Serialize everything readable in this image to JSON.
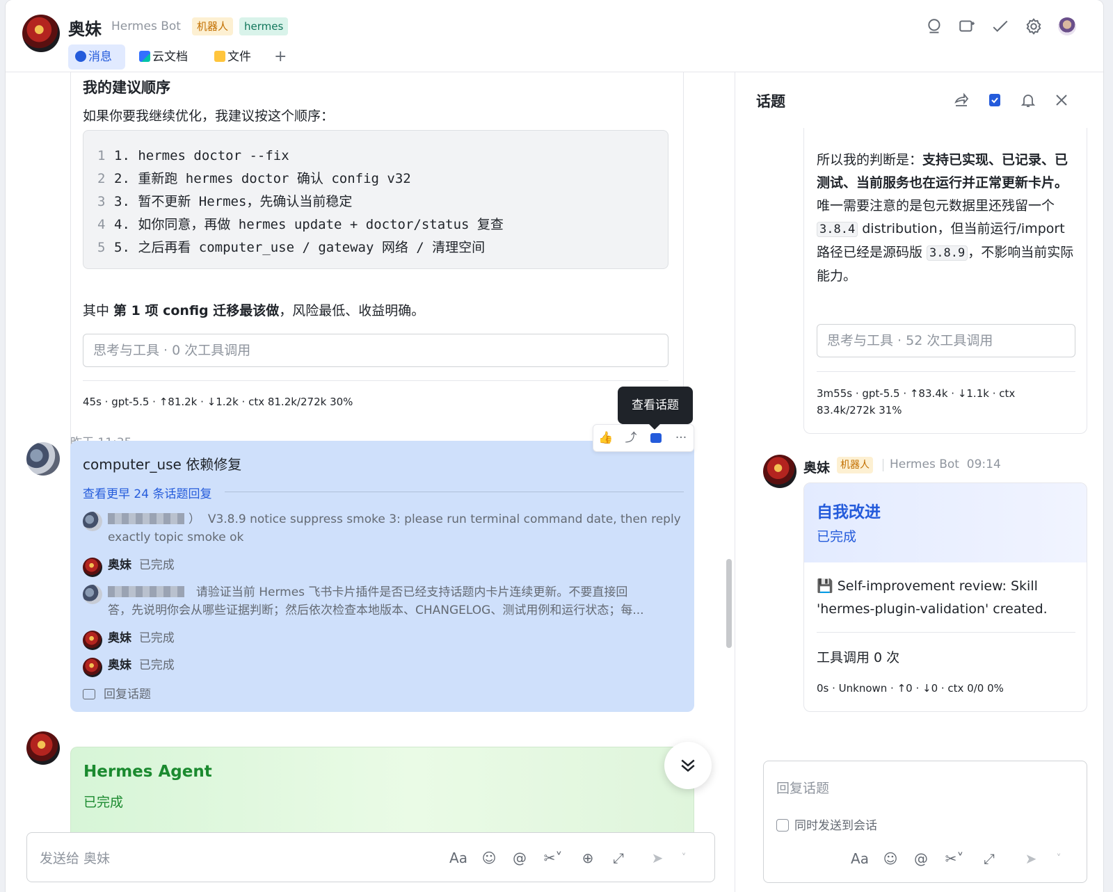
{
  "header": {
    "name": "奥妹",
    "subtitle": "Hermes Bot",
    "tag_robot": "机器人",
    "tag_hermes": "hermes",
    "tabs": [
      {
        "label": "消息"
      },
      {
        "label": "云文档"
      },
      {
        "label": "文件"
      },
      {
        "label": "+"
      }
    ]
  },
  "chat": {
    "card_top": {
      "heading": "我的建议顺序",
      "intro": "如果你要我继续优化，我建议按这个顺序：",
      "code_lines": [
        {
          "n": "1",
          "text": "1. hermes doctor --fix"
        },
        {
          "n": "2",
          "text": "2. 重新跑 hermes doctor 确认 config v32"
        },
        {
          "n": "3",
          "text": "3. 暂不更新 Hermes，先确认当前稳定"
        },
        {
          "n": "4",
          "text": "4. 如你同意，再做 hermes update + doctor/status 复查"
        },
        {
          "n": "5",
          "text": "5. 之后再看 computer_use / gateway 网络 / 清理空间"
        }
      ],
      "conclude_pre": "其中 ",
      "conclude_bold": "第 1 项 config 迁移最该做",
      "conclude_post": "，风险最低、收益明确。",
      "tools": "思考与工具 · 0 次工具调用",
      "meta": "45s · gpt-5.5 · ↑81.2k · ↓1.2k · ctx 81.2k/272k 30%"
    },
    "tooltip": "查看话题",
    "timestamp": "昨天 11:35",
    "topic": {
      "title": "computer_use 依赖修复",
      "more": "查看更早 24 条话题回复",
      "reply1_suffix": "）",
      "reply1_text": "V3.8.9 notice suppress smoke 3: please run terminal command date, then reply",
      "reply1_text2": "exactly topic smoke ok",
      "bot_name": "奥妹",
      "done": "已完成",
      "reply2_text": "请验证当前 Hermes 飞书卡片插件是否已经支持话题内卡片连续更新。不要直接回",
      "reply2_text2": "答，先说明你会从哪些证据判断；然后依次检查本地版本、CHANGELOG、测试用例和运行状态；每...",
      "reply_topic": "回复话题"
    },
    "agent_card": {
      "title": "Hermes Agent",
      "status": "已完成"
    },
    "composer_placeholder": "发送给 奥妹"
  },
  "panel": {
    "title": "话题",
    "card1": {
      "pre": "所以我的判断是：",
      "bold": "支持已实现、已记录、已测试、当前服务也在运行并正常更新卡片。",
      "t1": "唯一需要注意的是包元数据里还残留一个 ",
      "code1": "3.8.4",
      "t2": " distribution，但当前运行/import 路径已经是源码版 ",
      "code2": "3.8.9",
      "t3": "，不影响当前实际能力。",
      "tools": "思考与工具 · 52 次工具调用",
      "meta": "3m55s · gpt-5.5 · ↑83.4k · ↓1.1k · ctx 83.4k/272k 31%"
    },
    "msg": {
      "name": "奥妹",
      "tag": "机器人",
      "bot": "Hermes Bot",
      "time": "09:14"
    },
    "card2": {
      "title": "自我改进",
      "status": "已完成",
      "body": "💾 Self-improvement review: Skill 'hermes-plugin-validation' created.",
      "tools": "工具调用 0 次",
      "meta": "0s · Unknown · ↑0 · ↓0 · ctx 0/0 0%"
    },
    "composer_placeholder": "回复话题",
    "also_send": "同时发送到会话"
  }
}
